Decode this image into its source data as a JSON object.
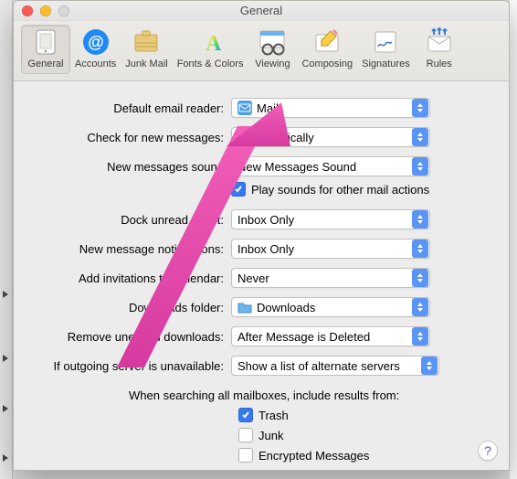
{
  "window": {
    "title": "General"
  },
  "toolbar": {
    "items": [
      {
        "label": "General",
        "icon": "general-icon"
      },
      {
        "label": "Accounts",
        "icon": "accounts-icon"
      },
      {
        "label": "Junk Mail",
        "icon": "junkmail-icon"
      },
      {
        "label": "Fonts & Colors",
        "icon": "fontscolors-icon"
      },
      {
        "label": "Viewing",
        "icon": "viewing-icon"
      },
      {
        "label": "Composing",
        "icon": "composing-icon"
      },
      {
        "label": "Signatures",
        "icon": "signatures-icon"
      },
      {
        "label": "Rules",
        "icon": "rules-icon"
      }
    ]
  },
  "form": {
    "default_reader": {
      "label": "Default email reader:",
      "value": "Mail"
    },
    "check_messages": {
      "label": "Check for new messages:",
      "value": "omatically"
    },
    "new_sound": {
      "label": "New messages sound",
      "value": "New Messages Sound"
    },
    "play_sounds": {
      "label": "Play sounds for other mail actions",
      "checked": true
    },
    "dock_unread": {
      "label": "Dock unread count:",
      "value": "Inbox Only"
    },
    "new_notifications": {
      "label": "New message notifications:",
      "value": "Inbox Only"
    },
    "add_invitations": {
      "label": "Add invitations to Calendar:",
      "value": "Never"
    },
    "downloads_folder": {
      "label": "Downloads folder:",
      "value": "Downloads"
    },
    "remove_unedited": {
      "label": "Remove unedited downloads:",
      "value": "After Message is Deleted"
    },
    "outgoing_unavailable": {
      "label": "If outgoing server is unavailable:",
      "value": "Show a list of alternate servers"
    },
    "search_section": "When searching all mailboxes, include results from:",
    "search_trash": {
      "label": "Trash",
      "checked": true
    },
    "search_junk": {
      "label": "Junk",
      "checked": false
    },
    "search_encrypted": {
      "label": "Encrypted Messages",
      "checked": false
    }
  },
  "help_label": "?"
}
